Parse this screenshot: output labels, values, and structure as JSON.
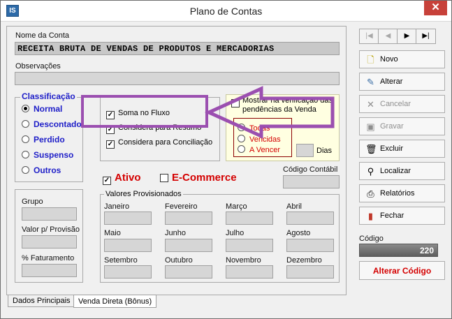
{
  "window": {
    "app_icon_text": "IS",
    "title": "Plano de Contas",
    "close_symbol": "✕"
  },
  "account": {
    "name_label": "Nome da Conta",
    "name_value": "RECEITA BRUTA DE VENDAS DE PRODUTOS E MERCADORIAS",
    "notes_label": "Observações",
    "notes_value": ""
  },
  "classification": {
    "title": "Classificação",
    "options": [
      "Normal",
      "Descontado",
      "Perdido",
      "Suspenso",
      "Outros"
    ],
    "selected": "Normal"
  },
  "flow_options": {
    "soma_no_fluxo": "Soma no Fluxo",
    "considera_resumo": "Considera para Resumo",
    "considera_conciliacao": "Considera para Conciliação"
  },
  "sales_verification": {
    "label": "Mostrar na verificação das pendências da Venda",
    "options": [
      "Todas",
      "Vencidas",
      "A Vencer"
    ],
    "days_label": "Dias"
  },
  "status": {
    "ativo_label": "Ativo",
    "ecommerce_label": "E-Commerce",
    "accent_color": "#d40000"
  },
  "accounting_code": {
    "label": "Código Contábil",
    "value": ""
  },
  "left_fields": {
    "grupo_label": "Grupo",
    "valor_provisao_label": "Valor p/ Provisão",
    "faturamento_label": "% Faturamento"
  },
  "provisioned": {
    "title": "Valores Provisionados",
    "months": [
      "Janeiro",
      "Fevereiro",
      "Março",
      "Abril",
      "Maio",
      "Junho",
      "Julho",
      "Agosto",
      "Setembro",
      "Outubro",
      "Novembro",
      "Dezembro"
    ]
  },
  "nav": {
    "first": "|◀",
    "prev": "◀",
    "next": "▶",
    "last": "▶|"
  },
  "buttons": {
    "novo": "Novo",
    "alterar": "Alterar",
    "cancelar": "Cancelar",
    "gravar": "Gravar",
    "excluir": "Excluir",
    "localizar": "Localizar",
    "relatorios": "Relatórios",
    "fechar": "Fechar"
  },
  "code": {
    "label": "Código",
    "value": "220",
    "change_label": "Alterar Código"
  },
  "tabs": [
    "Dados Principais",
    "Venda Direta (Bônus)"
  ],
  "annotation": {
    "color": "#9b4fb0"
  }
}
